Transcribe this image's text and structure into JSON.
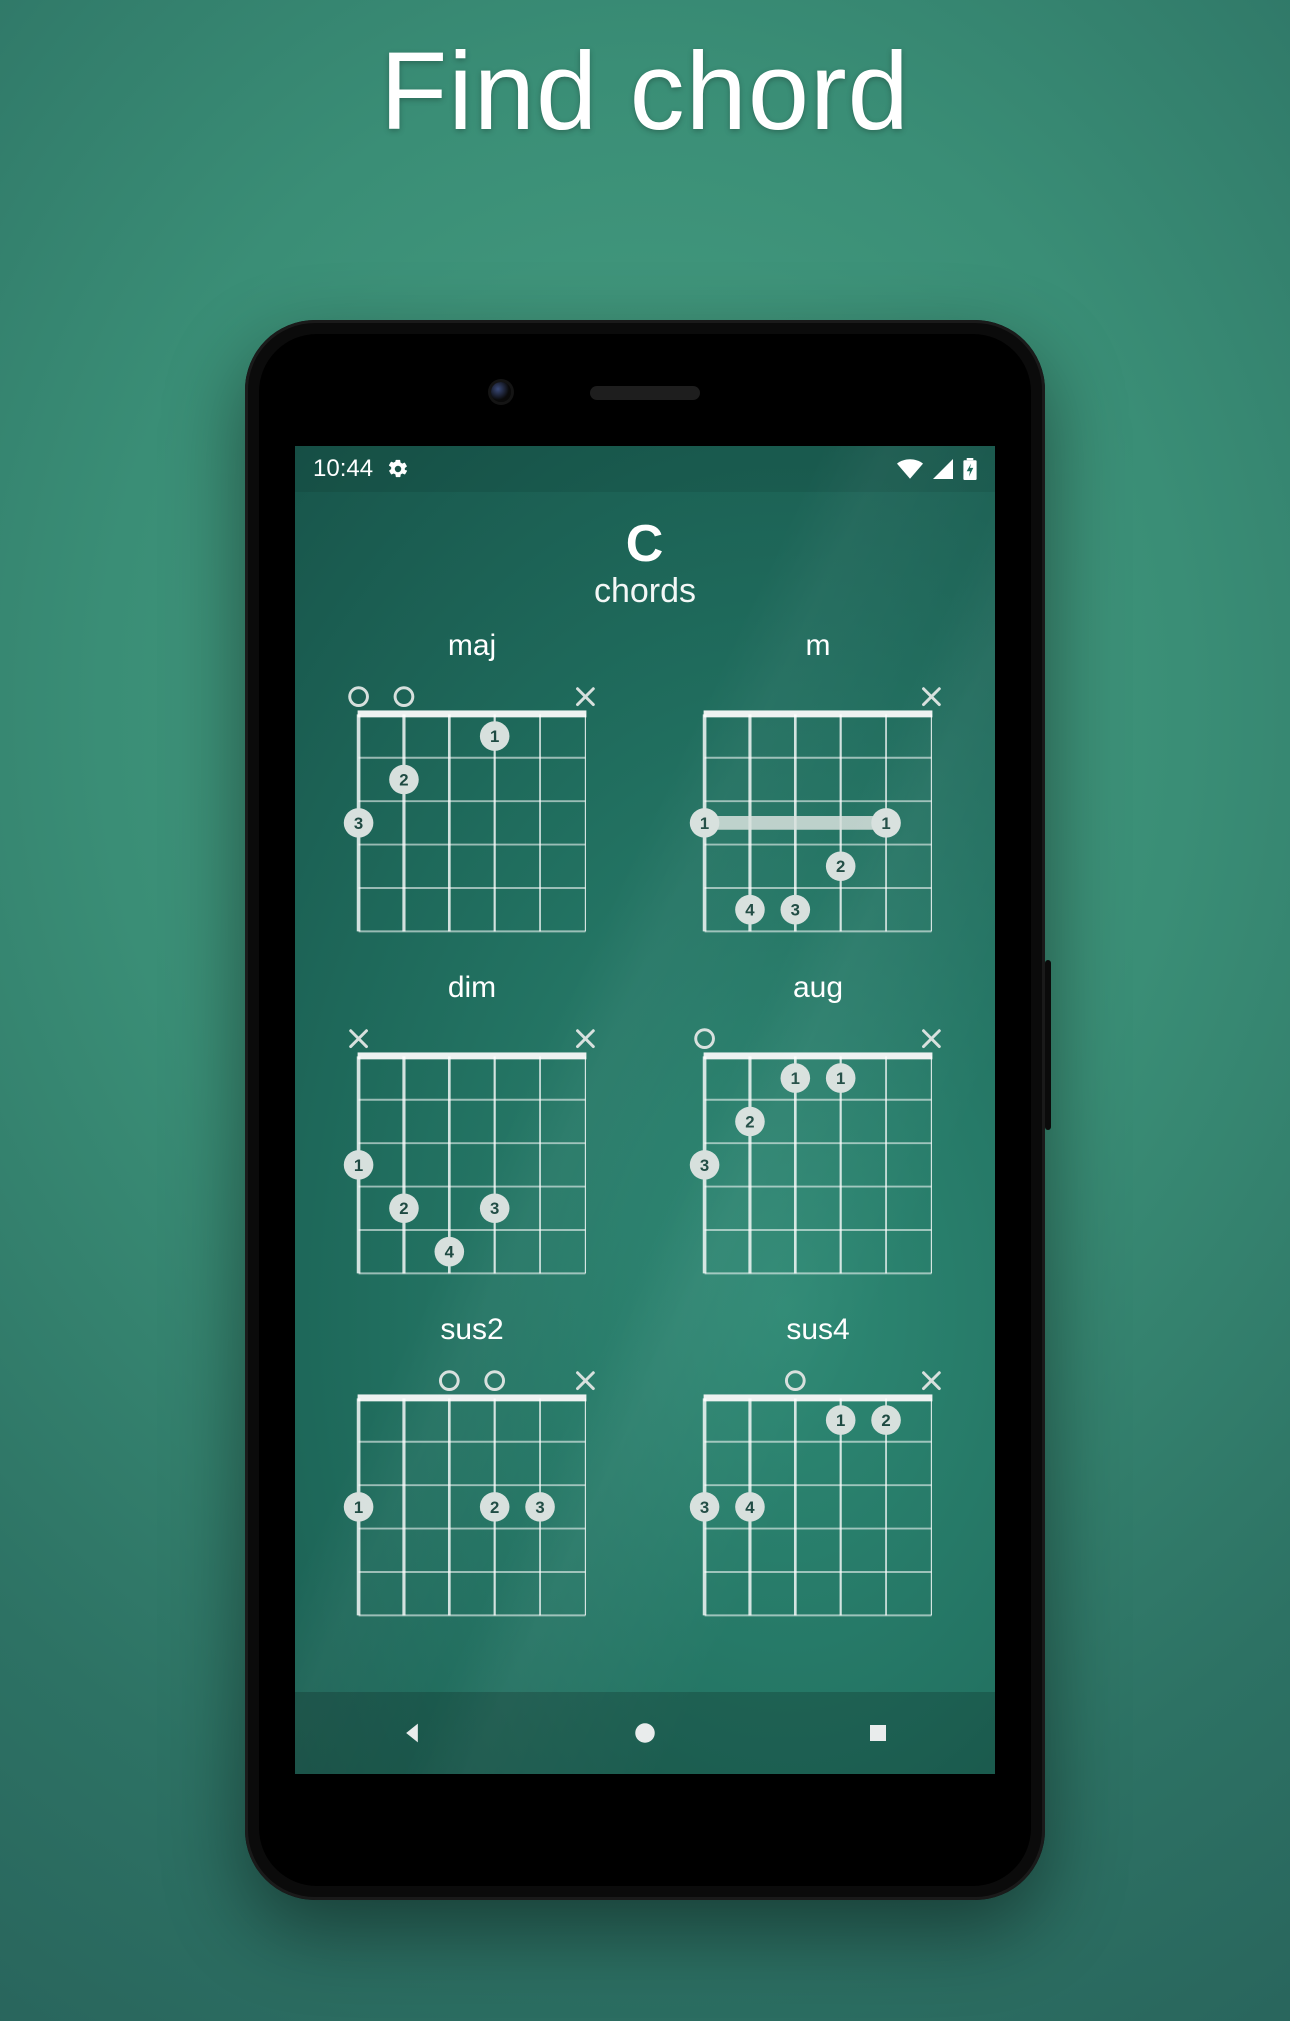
{
  "promo": {
    "title": "Find chord"
  },
  "status": {
    "time": "10:44"
  },
  "header": {
    "root": "C",
    "subtitle": "chords"
  },
  "chart_data": [
    {
      "type": "chord-diagram",
      "name": "maj",
      "strings": 6,
      "frets": 5,
      "markers": [
        "x",
        "",
        "",
        "",
        "o",
        "o"
      ],
      "notes": [
        {
          "string": 2,
          "fret": 1,
          "finger": 1
        },
        {
          "string": 4,
          "fret": 2,
          "finger": 2
        },
        {
          "string": 5,
          "fret": 3,
          "finger": 3
        }
      ],
      "barre": null
    },
    {
      "type": "chord-diagram",
      "name": "m",
      "strings": 6,
      "frets": 5,
      "markers": [
        "x",
        "",
        "",
        "",
        "",
        ""
      ],
      "notes": [
        {
          "string": 2,
          "fret": 4,
          "finger": 2
        },
        {
          "string": 3,
          "fret": 5,
          "finger": 3
        },
        {
          "string": 4,
          "fret": 5,
          "finger": 4
        }
      ],
      "barre": {
        "fret": 3,
        "from": 1,
        "to": 5,
        "finger": 1
      }
    },
    {
      "type": "chord-diagram",
      "name": "dim",
      "strings": 6,
      "frets": 5,
      "markers": [
        "x",
        "",
        "",
        "",
        "",
        "x"
      ],
      "notes": [
        {
          "string": 5,
          "fret": 3,
          "finger": 1
        },
        {
          "string": 4,
          "fret": 4,
          "finger": 2
        },
        {
          "string": 2,
          "fret": 4,
          "finger": 3
        },
        {
          "string": 3,
          "fret": 5,
          "finger": 4
        }
      ],
      "barre": null
    },
    {
      "type": "chord-diagram",
      "name": "aug",
      "strings": 6,
      "frets": 5,
      "markers": [
        "x",
        "",
        "",
        "",
        "",
        "o"
      ],
      "notes": [
        {
          "string": 2,
          "fret": 1,
          "finger": 1
        },
        {
          "string": 3,
          "fret": 1,
          "finger": 1
        },
        {
          "string": 4,
          "fret": 2,
          "finger": 2
        },
        {
          "string": 5,
          "fret": 3,
          "finger": 3
        }
      ],
      "barre": null
    },
    {
      "type": "chord-diagram",
      "name": "sus2",
      "strings": 6,
      "frets": 5,
      "markers": [
        "x",
        "",
        "o",
        "o",
        "",
        ""
      ],
      "notes": [
        {
          "string": 5,
          "fret": 3,
          "finger": 1
        },
        {
          "string": 2,
          "fret": 3,
          "finger": 2
        },
        {
          "string": 1,
          "fret": 3,
          "finger": 3
        }
      ],
      "barre": null
    },
    {
      "type": "chord-diagram",
      "name": "sus4",
      "strings": 6,
      "frets": 5,
      "markers": [
        "x",
        "",
        "",
        "o",
        "",
        ""
      ],
      "notes": [
        {
          "string": 2,
          "fret": 1,
          "finger": 1
        },
        {
          "string": 1,
          "fret": 1,
          "finger": 2
        },
        {
          "string": 5,
          "fret": 3,
          "finger": 3
        },
        {
          "string": 4,
          "fret": 3,
          "finger": 4
        }
      ],
      "barre": null
    }
  ]
}
